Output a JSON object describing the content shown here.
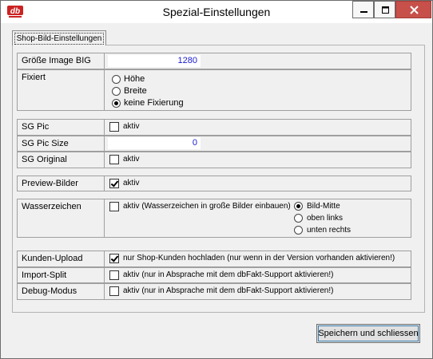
{
  "window": {
    "title": "Spezial-Einstellungen",
    "app_icon_text": "db",
    "brand_color": "#cc2222"
  },
  "tabs": [
    {
      "label": "Shop-Bild-Einstellungen",
      "active": true
    }
  ],
  "fields": {
    "image_big": {
      "label": "Größe Image BIG",
      "value": "1280"
    },
    "fixiert": {
      "label": "Fixiert",
      "options": [
        {
          "label": "Höhe",
          "selected": false
        },
        {
          "label": "Breite",
          "selected": false
        },
        {
          "label": "keine Fixierung",
          "selected": true
        }
      ]
    },
    "sg_pic": {
      "label": "SG Pic",
      "checkbox_label": "aktiv",
      "checked": false
    },
    "sg_pic_size": {
      "label": "SG Pic Size",
      "value": "0"
    },
    "sg_original": {
      "label": "SG Original",
      "checkbox_label": "aktiv",
      "checked": false
    },
    "preview": {
      "label": "Preview-Bilder",
      "checkbox_label": "aktiv",
      "checked": true
    },
    "wasserzeichen": {
      "label": "Wasserzeichen",
      "checkbox_label": "aktiv (Wasserzeichen in große Bilder einbauen)",
      "checked": false,
      "options": [
        {
          "label": "Bild-Mitte",
          "selected": true
        },
        {
          "label": "oben links",
          "selected": false
        },
        {
          "label": "unten rechts",
          "selected": false
        }
      ]
    },
    "kunden_upload": {
      "label": "Kunden-Upload",
      "checkbox_label": "nur Shop-Kunden hochladen (nur wenn in der Version vorhanden aktivieren!)",
      "checked": true
    },
    "import_split": {
      "label": "Import-Split",
      "checkbox_label": "aktiv (nur in Absprache mit dem dbFakt-Support aktivieren!)",
      "checked": false
    },
    "debug": {
      "label": "Debug-Modus",
      "checkbox_label": "aktiv (nur in Absprache mit dem dbFakt-Support aktivieren!)",
      "checked": false
    }
  },
  "buttons": {
    "save": "Speichern und schliessen"
  }
}
